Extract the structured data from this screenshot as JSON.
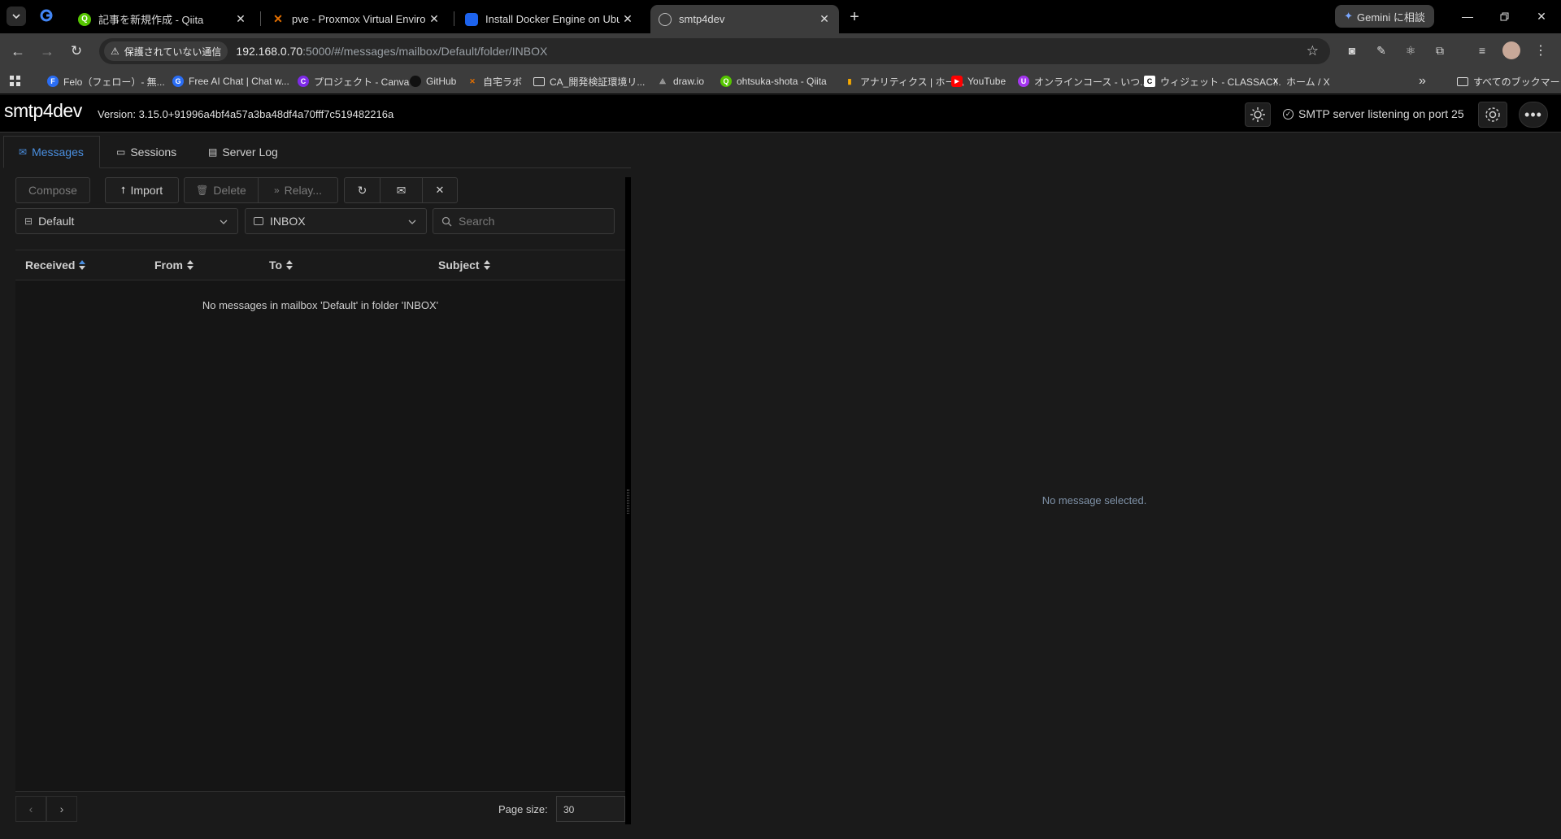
{
  "browser": {
    "tabs": [
      {
        "title": "記事を新規作成 - Qiita",
        "icon": "qiita-icon",
        "color": "#55c500"
      },
      {
        "title": "pve - Proxmox Virtual Environm",
        "icon": "proxmox-icon",
        "color": "#e57000"
      },
      {
        "title": "Install Docker Engine on Ubuntu",
        "icon": "docker-icon",
        "color": "#1d63ed"
      },
      {
        "title": "smtp4dev",
        "icon": "globe-icon",
        "color": "#9aa0a6"
      }
    ],
    "gemini_button": "Gemini に相談",
    "security_label": "保護されていない通信",
    "url_host": "192.168.0.70",
    "url_rest": ":5000/#/messages/mailbox/Default/folder/INBOX",
    "bookmarks": [
      {
        "label": "Felo（フェロー）- 無...",
        "color": "#2a6df4",
        "glyph": "F"
      },
      {
        "label": "Free AI Chat | Chat w...",
        "color": "#2a6df4",
        "glyph": "G"
      },
      {
        "label": "プロジェクト - Canva",
        "color": "#7d2ae8",
        "glyph": "C"
      },
      {
        "label": "GitHub",
        "color": "#111111",
        "glyph": ""
      },
      {
        "label": "自宅ラボ",
        "color": "#e57000",
        "glyph": "X"
      },
      {
        "label": "CA_開発検証環境リ...",
        "color": "folder",
        "glyph": ""
      },
      {
        "label": "draw.io",
        "color": "#888888",
        "glyph": ""
      },
      {
        "label": "ohtsuka-shota - Qiita",
        "color": "#55c500",
        "glyph": "Q"
      },
      {
        "label": "アナリティクス | ホーム",
        "color": "#f9ab00",
        "glyph": ""
      },
      {
        "label": "YouTube",
        "color": "#ff0000",
        "glyph": "▶"
      },
      {
        "label": "オンラインコース - いつ...",
        "color": "#a435f0",
        "glyph": "U"
      },
      {
        "label": "ウィジェット - CLASSAC...",
        "color": "#ffffff",
        "glyph": "C"
      },
      {
        "label": "ホーム / X",
        "color": "#000000",
        "glyph": "X"
      }
    ],
    "all_bookmarks": "すべてのブックマーク",
    "overflow": "»"
  },
  "app": {
    "logo": "smtp4dev",
    "version": "Version: 3.15.0+91996a4bf4a57a3ba48df4a70fff7c519482216a",
    "status": "SMTP server listening on port 25",
    "tabs": {
      "messages": "Messages",
      "sessions": "Sessions",
      "server_log": "Server Log"
    },
    "toolbar": {
      "compose": "Compose",
      "import": "Import",
      "delete": "Delete",
      "relay": "Relay..."
    },
    "mailbox": "Default",
    "folder": "INBOX",
    "search_placeholder": "Search",
    "columns": {
      "received": "Received",
      "from": "From",
      "to": "To",
      "subject": "Subject"
    },
    "empty_message": "No messages in mailbox 'Default' in folder 'INBOX'",
    "page_size_label": "Page size:",
    "page_size": "30",
    "no_selection": "No message selected.",
    "accent": "#4a8fe0"
  }
}
